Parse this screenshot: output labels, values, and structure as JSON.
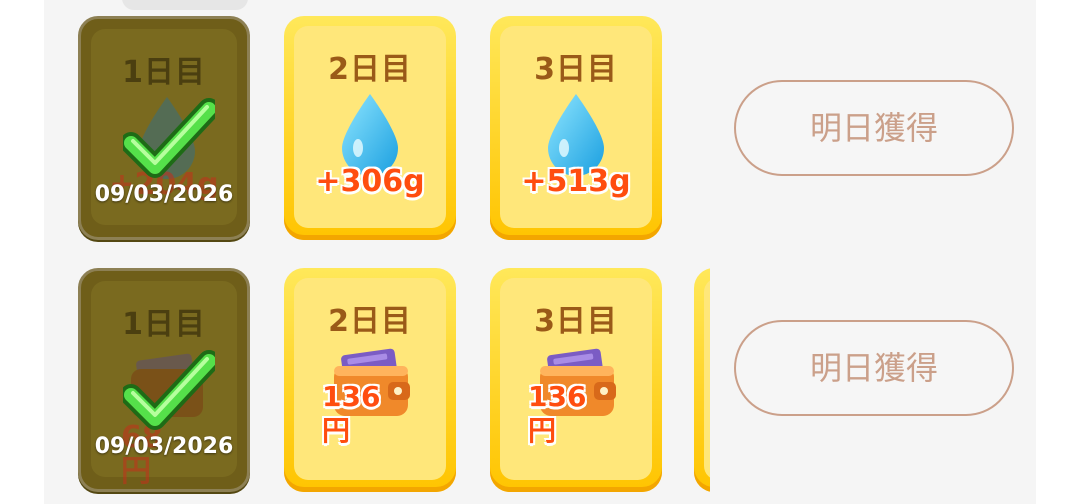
{
  "rows": [
    {
      "cards": [
        {
          "day": "1日目",
          "reward": "+204g",
          "status": "claimed",
          "date": "09/03/2026",
          "icon": "water-drop-icon"
        },
        {
          "day": "2日目",
          "reward": "+306g",
          "status": "pending",
          "icon": "water-drop-icon"
        },
        {
          "day": "3日目",
          "reward": "+513g",
          "status": "pending",
          "icon": "water-drop-icon"
        }
      ],
      "button_label": "明日獲得"
    },
    {
      "cards": [
        {
          "day": "1日目",
          "reward": "68円",
          "status": "claimed",
          "date": "09/03/2026",
          "icon": "wallet-icon"
        },
        {
          "day": "2日目",
          "reward": "136円",
          "status": "pending",
          "icon": "wallet-icon"
        },
        {
          "day": "3日目",
          "reward": "136円",
          "status": "pending",
          "icon": "wallet-icon"
        }
      ],
      "button_label": "明日獲得"
    }
  ],
  "colors": {
    "card_gold": "#ffd21f",
    "card_done": "#6f5e19",
    "reward_text": "#ff4d0f",
    "day_text": "#9a5a18",
    "button_border": "#cba08a",
    "panel_bg": "#f5f5f5"
  }
}
